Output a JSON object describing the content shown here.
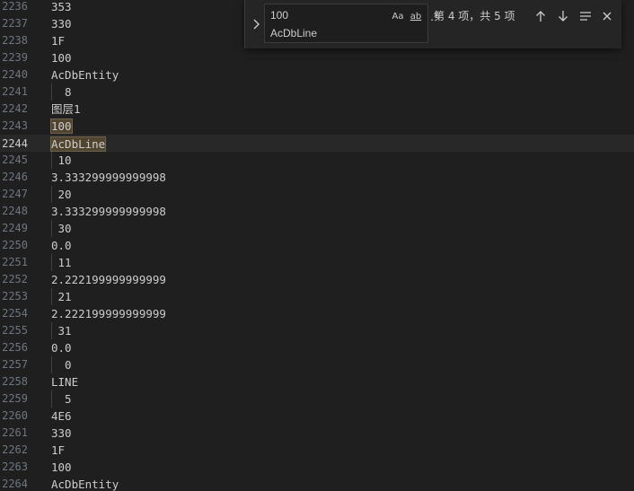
{
  "editor": {
    "lines": [
      {
        "n": "2236",
        "text": "353",
        "indent": false
      },
      {
        "n": "2237",
        "text": "330",
        "indent": false
      },
      {
        "n": "2238",
        "text": "1F",
        "indent": false
      },
      {
        "n": "2239",
        "text": "100",
        "indent": false
      },
      {
        "n": "2240",
        "text": "AcDbEntity",
        "indent": false
      },
      {
        "n": "2241",
        "text": "  8",
        "indent": true
      },
      {
        "n": "2242",
        "text": "图层1",
        "indent": false
      },
      {
        "n": "2243",
        "text": "100",
        "indent": false,
        "match": "current"
      },
      {
        "n": "2244",
        "text": "AcDbLine",
        "indent": false,
        "match": "current",
        "current": true
      },
      {
        "n": "2245",
        "text": " 10",
        "indent": true
      },
      {
        "n": "2246",
        "text": "3.333299999999998",
        "indent": false
      },
      {
        "n": "2247",
        "text": " 20",
        "indent": true
      },
      {
        "n": "2248",
        "text": "3.333299999999998",
        "indent": false
      },
      {
        "n": "2249",
        "text": " 30",
        "indent": true
      },
      {
        "n": "2250",
        "text": "0.0",
        "indent": false
      },
      {
        "n": "2251",
        "text": " 11",
        "indent": true
      },
      {
        "n": "2252",
        "text": "2.222199999999999",
        "indent": false
      },
      {
        "n": "2253",
        "text": " 21",
        "indent": true
      },
      {
        "n": "2254",
        "text": "2.222199999999999",
        "indent": false
      },
      {
        "n": "2255",
        "text": " 31",
        "indent": true
      },
      {
        "n": "2256",
        "text": "0.0",
        "indent": false
      },
      {
        "n": "2257",
        "text": "  0",
        "indent": true
      },
      {
        "n": "2258",
        "text": "LINE",
        "indent": false
      },
      {
        "n": "2259",
        "text": "  5",
        "indent": true
      },
      {
        "n": "2260",
        "text": "4E6",
        "indent": false
      },
      {
        "n": "2261",
        "text": "330",
        "indent": false
      },
      {
        "n": "2262",
        "text": "1F",
        "indent": false
      },
      {
        "n": "2263",
        "text": "100",
        "indent": false
      },
      {
        "n": "2264",
        "text": "AcDbEntity",
        "indent": false
      }
    ]
  },
  "find": {
    "search_value": "100",
    "search_value_line2": "AcDbLine",
    "opt_case_label": "Aa",
    "opt_word_label": "ab",
    "opt_regex_label": ".*",
    "match_count": "第 4 项，共 5 项",
    "icons": {
      "toggle": "chevron-right-icon",
      "prev": "arrow-up-icon",
      "next": "arrow-down-icon",
      "selection": "find-in-selection-icon",
      "close": "close-icon"
    }
  },
  "colors": {
    "background": "#1f1f1f",
    "line_number": "#6e7681",
    "text": "#cccccc",
    "current_match": "#514530",
    "widget_bg": "#252526"
  }
}
